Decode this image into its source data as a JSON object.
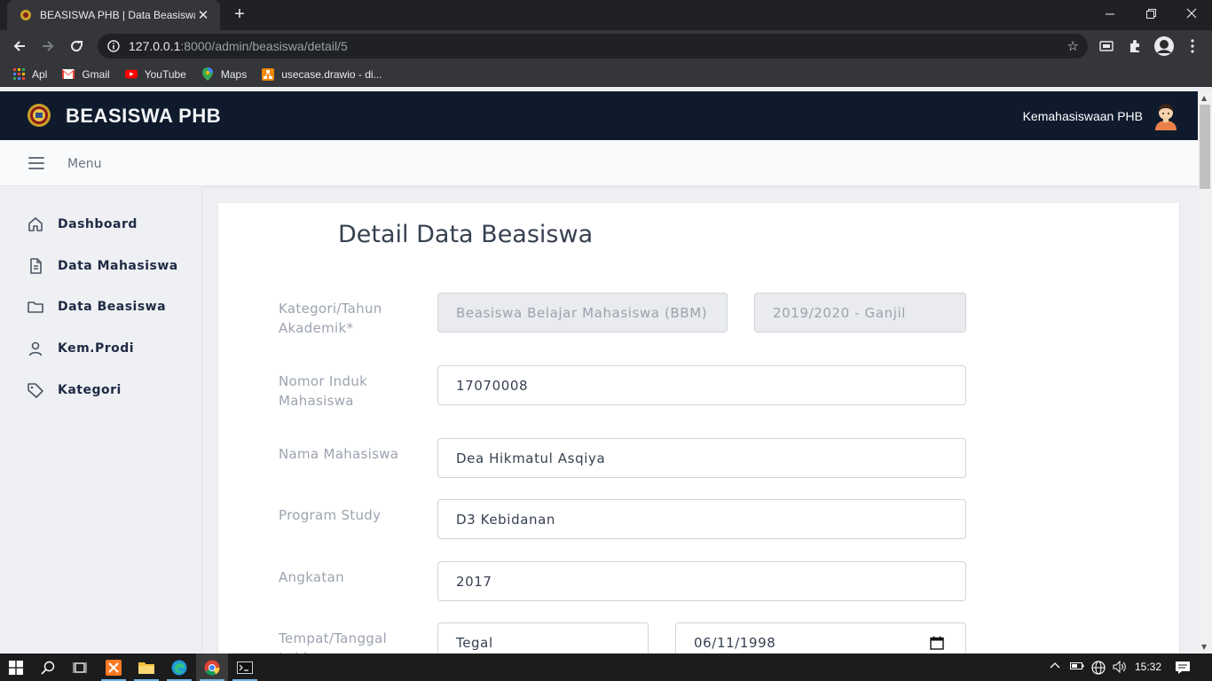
{
  "browser": {
    "tab_title": "BEASISWA PHB | Data Beasiswa",
    "url_host": "127.0.0.1",
    "url_path": ":8000/admin/beasiswa/detail/5",
    "bookmarks": [
      "Apl",
      "Gmail",
      "YouTube",
      "Maps",
      "usecase.drawio - di..."
    ]
  },
  "header": {
    "brand": "BEASISWA PHB",
    "user_name": "Kemahasiswaan PHB"
  },
  "menubar": {
    "label": "Menu"
  },
  "sidebar": {
    "items": [
      {
        "label": "Dashboard",
        "icon": "home-icon"
      },
      {
        "label": "Data Mahasiswa",
        "icon": "document-icon"
      },
      {
        "label": "Data Beasiswa",
        "icon": "folder-icon"
      },
      {
        "label": "Kem.Prodi",
        "icon": "user-icon"
      },
      {
        "label": "Kategori",
        "icon": "tag-icon"
      }
    ]
  },
  "form": {
    "title": "Detail Data Beasiswa",
    "kategori_label": "Kategori/Tahun Akademik*",
    "kategori_value": "Beasiswa Belajar Mahasiswa (BBM)",
    "tahun_value": "2019/2020 - Ganjil",
    "nim_label": "Nomor Induk Mahasiswa",
    "nim_value": "17070008",
    "nama_label": "Nama Mahasiswa",
    "nama_value": "Dea Hikmatul Asqiya",
    "prodi_label": "Program Study",
    "prodi_value": "D3 Kebidanan",
    "angkatan_label": "Angkatan",
    "angkatan_value": "2017",
    "ttl_label": "Tempat/Tanggal Lahir",
    "tempat_value": "Tegal",
    "tanggal_value": "06/11/1998"
  },
  "taskbar": {
    "clock": "15:32"
  }
}
